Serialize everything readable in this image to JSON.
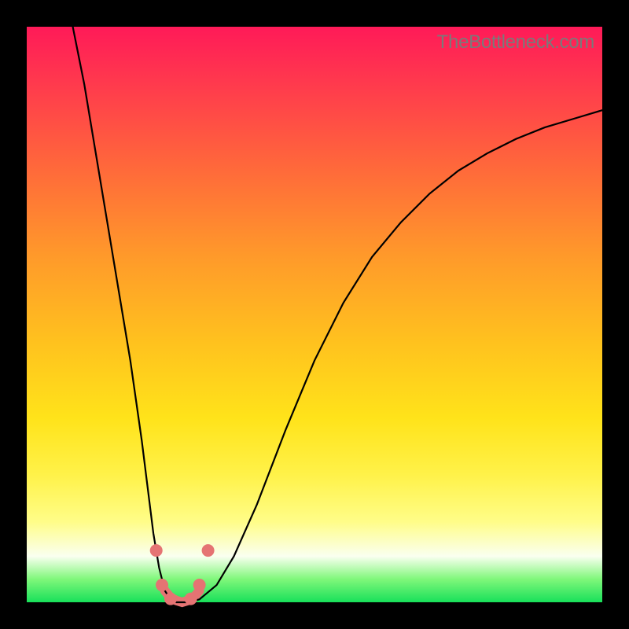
{
  "watermark": "TheBottleneck.com",
  "chart_data": {
    "type": "line",
    "title": "",
    "xlabel": "",
    "ylabel": "",
    "xlim": [
      0,
      100
    ],
    "ylim": [
      0,
      100
    ],
    "series": [
      {
        "name": "curve",
        "x": [
          8,
          10,
          12,
          14,
          16,
          18,
          20,
          21,
          22,
          23,
          24,
          25,
          26,
          28,
          30,
          33,
          36,
          40,
          45,
          50,
          55,
          60,
          65,
          70,
          75,
          80,
          85,
          90,
          95,
          100
        ],
        "values": [
          100,
          90,
          78,
          66,
          54,
          42,
          28,
          20,
          12,
          6,
          2,
          0.5,
          0,
          0,
          0.5,
          3,
          8,
          17,
          30,
          42,
          52,
          60,
          66,
          71,
          75,
          78,
          80.5,
          82.5,
          84,
          85.5
        ]
      },
      {
        "name": "optimal-base",
        "x": [
          24,
          25,
          26,
          27,
          28,
          29,
          30
        ],
        "values": [
          2,
          0.8,
          0.3,
          0,
          0.3,
          0.8,
          2
        ]
      }
    ],
    "markers": [
      {
        "x": 22.5,
        "y": 9
      },
      {
        "x": 23.5,
        "y": 3
      },
      {
        "x": 25.0,
        "y": 0.6
      },
      {
        "x": 28.5,
        "y": 0.6
      },
      {
        "x": 30.0,
        "y": 3
      },
      {
        "x": 31.5,
        "y": 9
      }
    ],
    "colors": {
      "gradient_top": "#ff1a58",
      "gradient_bottom": "#18e05a",
      "curve": "#000000",
      "highlight": "#e57373"
    }
  }
}
